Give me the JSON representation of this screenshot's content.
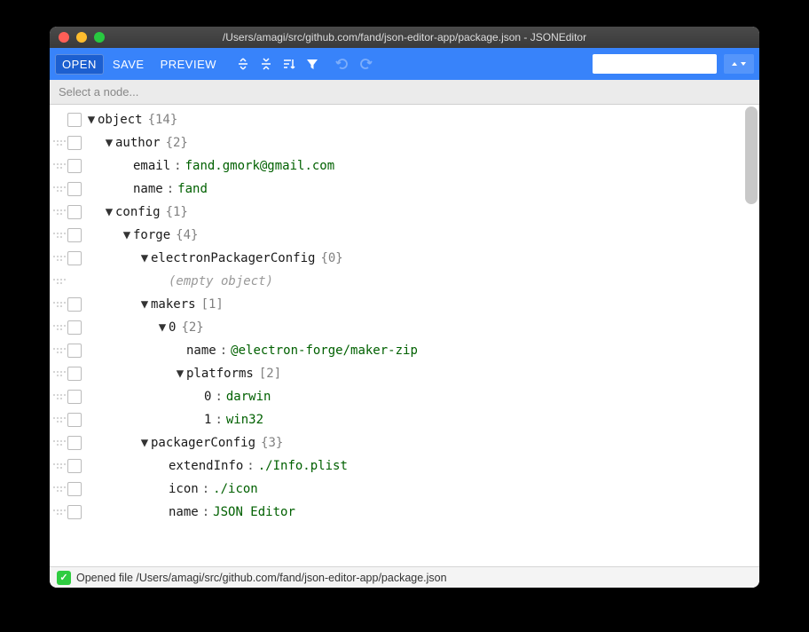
{
  "window_title": "/Users/amagi/src/github.com/fand/json-editor-app/package.json - JSONEditor",
  "toolbar": {
    "open": "OPEN",
    "save": "SAVE",
    "preview": "PREVIEW"
  },
  "pathbar_placeholder": "Select a node...",
  "search_placeholder": "",
  "tree": [
    {
      "depth": 0,
      "drag": false,
      "menu": true,
      "caret": "down",
      "key": "object",
      "meta": "{14}"
    },
    {
      "depth": 1,
      "drag": true,
      "menu": true,
      "caret": "down",
      "key": "author",
      "meta": "{2}"
    },
    {
      "depth": 2,
      "drag": true,
      "menu": true,
      "caret": "none",
      "key": "email",
      "sep": ":",
      "val": "fand.gmork@gmail.com"
    },
    {
      "depth": 2,
      "drag": true,
      "menu": true,
      "caret": "none",
      "key": "name",
      "sep": ":",
      "val": "fand"
    },
    {
      "depth": 1,
      "drag": true,
      "menu": true,
      "caret": "down",
      "key": "config",
      "meta": "{1}"
    },
    {
      "depth": 2,
      "drag": true,
      "menu": true,
      "caret": "down",
      "key": "forge",
      "meta": "{4}"
    },
    {
      "depth": 3,
      "drag": true,
      "menu": true,
      "caret": "down",
      "key": "electronPackagerConfig",
      "meta": "{0}"
    },
    {
      "depth": 4,
      "drag": true,
      "menu": false,
      "caret": "none",
      "empty": "(empty object)"
    },
    {
      "depth": 3,
      "drag": true,
      "menu": true,
      "caret": "down",
      "key": "makers",
      "meta": "[1]"
    },
    {
      "depth": 4,
      "drag": true,
      "menu": true,
      "caret": "down",
      "key": "0",
      "meta": "{2}"
    },
    {
      "depth": 5,
      "drag": true,
      "menu": true,
      "caret": "none",
      "key": "name",
      "sep": ":",
      "val": "@electron-forge/maker-zip"
    },
    {
      "depth": 5,
      "drag": true,
      "menu": true,
      "caret": "down",
      "key": "platforms",
      "meta": "[2]"
    },
    {
      "depth": 6,
      "drag": true,
      "menu": true,
      "caret": "none",
      "key": "0",
      "sep": ":",
      "val": "darwin"
    },
    {
      "depth": 6,
      "drag": true,
      "menu": true,
      "caret": "none",
      "key": "1",
      "sep": ":",
      "val": "win32"
    },
    {
      "depth": 3,
      "drag": true,
      "menu": true,
      "caret": "down",
      "key": "packagerConfig",
      "meta": "{3}"
    },
    {
      "depth": 4,
      "drag": true,
      "menu": true,
      "caret": "none",
      "key": "extendInfo",
      "sep": ":",
      "val": "./Info.plist"
    },
    {
      "depth": 4,
      "drag": true,
      "menu": true,
      "caret": "none",
      "key": "icon",
      "sep": ":",
      "val": "./icon"
    },
    {
      "depth": 4,
      "drag": true,
      "menu": true,
      "caret": "none",
      "key": "name",
      "sep": ":",
      "val": "JSON Editor"
    }
  ],
  "status_text": "Opened file /Users/amagi/src/github.com/fand/json-editor-app/package.json"
}
